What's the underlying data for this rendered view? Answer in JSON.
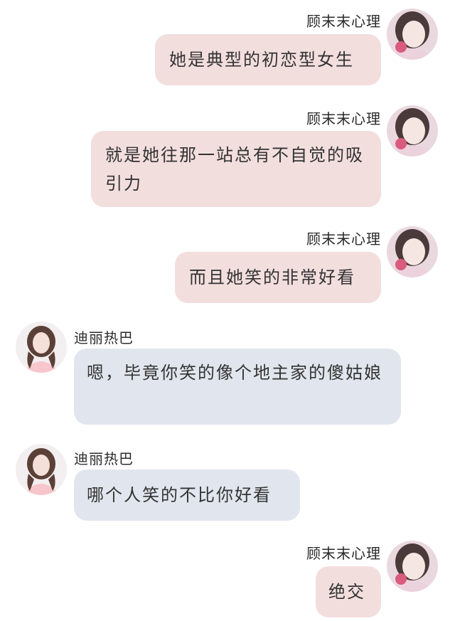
{
  "colors": {
    "sent_bubble": "#f3dede",
    "received_bubble": "#e1e6ee",
    "background": "#ffffff",
    "text": "#333333"
  },
  "senders": {
    "self": "顾末末心理",
    "other": "迪丽热巴"
  },
  "messages": [
    {
      "sender": "顾末末心理",
      "direction": "sent",
      "text": "她是典型的初恋型女生"
    },
    {
      "sender": "顾末末心理",
      "direction": "sent",
      "text": "就是她往那一站总有不自觉的吸引力"
    },
    {
      "sender": "顾末末心理",
      "direction": "sent",
      "text": "而且她笑的非常好看"
    },
    {
      "sender": "迪丽热巴",
      "direction": "received",
      "text": "嗯，毕竟你笑的像个地主家的傻姑娘"
    },
    {
      "sender": "迪丽热巴",
      "direction": "received",
      "text": "哪个人笑的不比你好看"
    },
    {
      "sender": "顾末末心理",
      "direction": "sent",
      "text": "绝交"
    }
  ]
}
